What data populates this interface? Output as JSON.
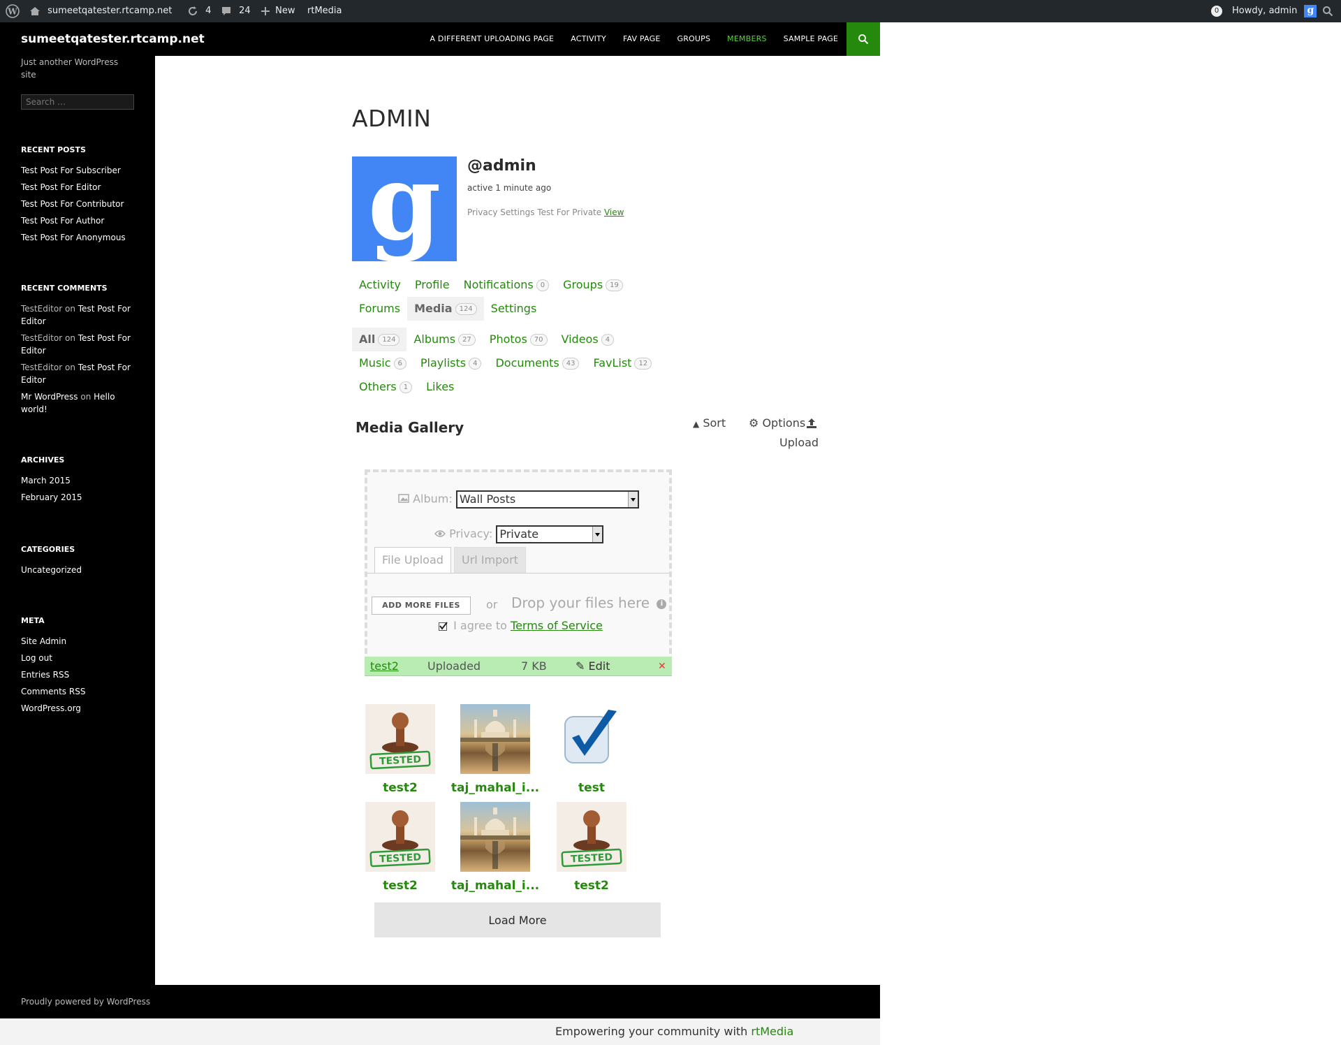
{
  "admin_bar": {
    "site_name": "sumeetqatester.rtcamp.net",
    "updates_count": "4",
    "comments_count": "24",
    "new_label": "New",
    "rtmedia_label": "rtMedia",
    "notifications_count": "0",
    "howdy": "Howdy, admin"
  },
  "header": {
    "site_title": "sumeetqatester.rtcamp.net",
    "nav": [
      "A DIFFERENT UPLOADING PAGE",
      "ACTIVITY",
      "FAV PAGE",
      "GROUPS",
      "MEMBERS",
      "SAMPLE PAGE"
    ],
    "current_nav": "MEMBERS"
  },
  "sidebar": {
    "description": "Just another WordPress site",
    "search_placeholder": "Search …",
    "recent_posts_title": "RECENT POSTS",
    "recent_posts": [
      "Test Post For Subscriber",
      "Test Post For Editor",
      "Test Post For Contributor",
      "Test Post For Author",
      "Test Post For Anonymous"
    ],
    "recent_comments_title": "RECENT COMMENTS",
    "recent_comments": [
      {
        "author": "TestEditor",
        "on": "on",
        "post": "Test Post For Editor"
      },
      {
        "author": "TestEditor",
        "on": "on",
        "post": "Test Post For Editor"
      },
      {
        "author": "TestEditor",
        "on": "on",
        "post": "Test Post For Editor"
      },
      {
        "author": "Mr WordPress",
        "on": "on",
        "post": "Hello world!"
      }
    ],
    "archives_title": "ARCHIVES",
    "archives": [
      "March 2015",
      "February 2015"
    ],
    "categories_title": "CATEGORIES",
    "categories": [
      "Uncategorized"
    ],
    "meta_title": "META",
    "meta": [
      "Site Admin",
      "Log out",
      "Entries RSS",
      "Comments RSS",
      "WordPress.org"
    ]
  },
  "profile": {
    "page_title": "ADMIN",
    "avatar_letter": "g",
    "handle": "@admin",
    "activity": "active 1 minute ago",
    "privacy_note": "Privacy Settings Test For Private",
    "privacy_link": "View"
  },
  "profile_tabs": [
    {
      "label": "Activity",
      "count": ""
    },
    {
      "label": "Profile",
      "count": ""
    },
    {
      "label": "Notifications",
      "count": "0"
    },
    {
      "label": "Groups",
      "count": "19"
    },
    {
      "label": "Forums",
      "count": ""
    },
    {
      "label": "Media",
      "count": "124"
    },
    {
      "label": "Settings",
      "count": ""
    }
  ],
  "media_tabs": [
    {
      "label": "All",
      "count": "124"
    },
    {
      "label": "Albums",
      "count": "27"
    },
    {
      "label": "Photos",
      "count": "70"
    },
    {
      "label": "Videos",
      "count": "4"
    },
    {
      "label": "Music",
      "count": "6"
    },
    {
      "label": "Playlists",
      "count": "4"
    },
    {
      "label": "Documents",
      "count": "43"
    },
    {
      "label": "FavList",
      "count": "12"
    },
    {
      "label": "Others",
      "count": "1"
    },
    {
      "label": "Likes",
      "count": ""
    }
  ],
  "gallery": {
    "title": "Media Gallery",
    "sort": "Sort",
    "options": "Options",
    "upload": "Upload"
  },
  "uploader": {
    "album_label": "Album:",
    "album_value": "Wall Posts",
    "privacy_label": "Privacy:",
    "privacy_value": "Private",
    "tab_file": "File Upload",
    "tab_url": "Url Import",
    "add_files": "ADD MORE FILES",
    "or": "or",
    "drop_text": "Drop your files here",
    "agree_text": "I agree to",
    "terms_link": "Terms of Service",
    "file_name": "test2",
    "file_status": "Uploaded",
    "file_size": "7 KB",
    "edit_label": "Edit"
  },
  "media_items": [
    {
      "title": "test2",
      "thumb": "stamp"
    },
    {
      "title": "taj_mahal_i...",
      "thumb": "taj"
    },
    {
      "title": "test",
      "thumb": "check"
    },
    {
      "title": "test2",
      "thumb": "stamp"
    },
    {
      "title": "taj_mahal_i...",
      "thumb": "taj"
    },
    {
      "title": "test2",
      "thumb": "stamp"
    }
  ],
  "load_more": "Load More",
  "footer": {
    "credit": "Proudly powered by WordPress",
    "rtmedia_prefix": "Empowering your community with",
    "rtmedia_link": "rtMedia"
  },
  "colors": {
    "accent": "#24890d",
    "nav_current": "#55d737",
    "avatar_blue": "#4285f4"
  }
}
